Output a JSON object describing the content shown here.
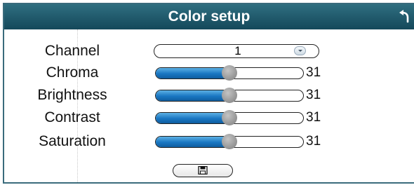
{
  "dialog": {
    "title": "Color setup",
    "back_icon": "return-arrow-icon"
  },
  "channel": {
    "label": "Channel",
    "value": "1",
    "dropdown_icon": "chevron-down-icon"
  },
  "sliders": [
    {
      "key": "chroma",
      "label": "Chroma",
      "value": "31",
      "fraction": 0.5
    },
    {
      "key": "brightness",
      "label": "Brightness",
      "value": "31",
      "fraction": 0.5
    },
    {
      "key": "contrast",
      "label": "Contrast",
      "value": "31",
      "fraction": 0.5
    },
    {
      "key": "saturation",
      "label": "Saturation",
      "value": "31",
      "fraction": 0.5
    }
  ],
  "save_button": {
    "icon": "save-icon"
  },
  "colors": {
    "title_bar": "#1f5b6d",
    "slider_fill": "#1976c2",
    "thumb": "#a0a0a0"
  }
}
